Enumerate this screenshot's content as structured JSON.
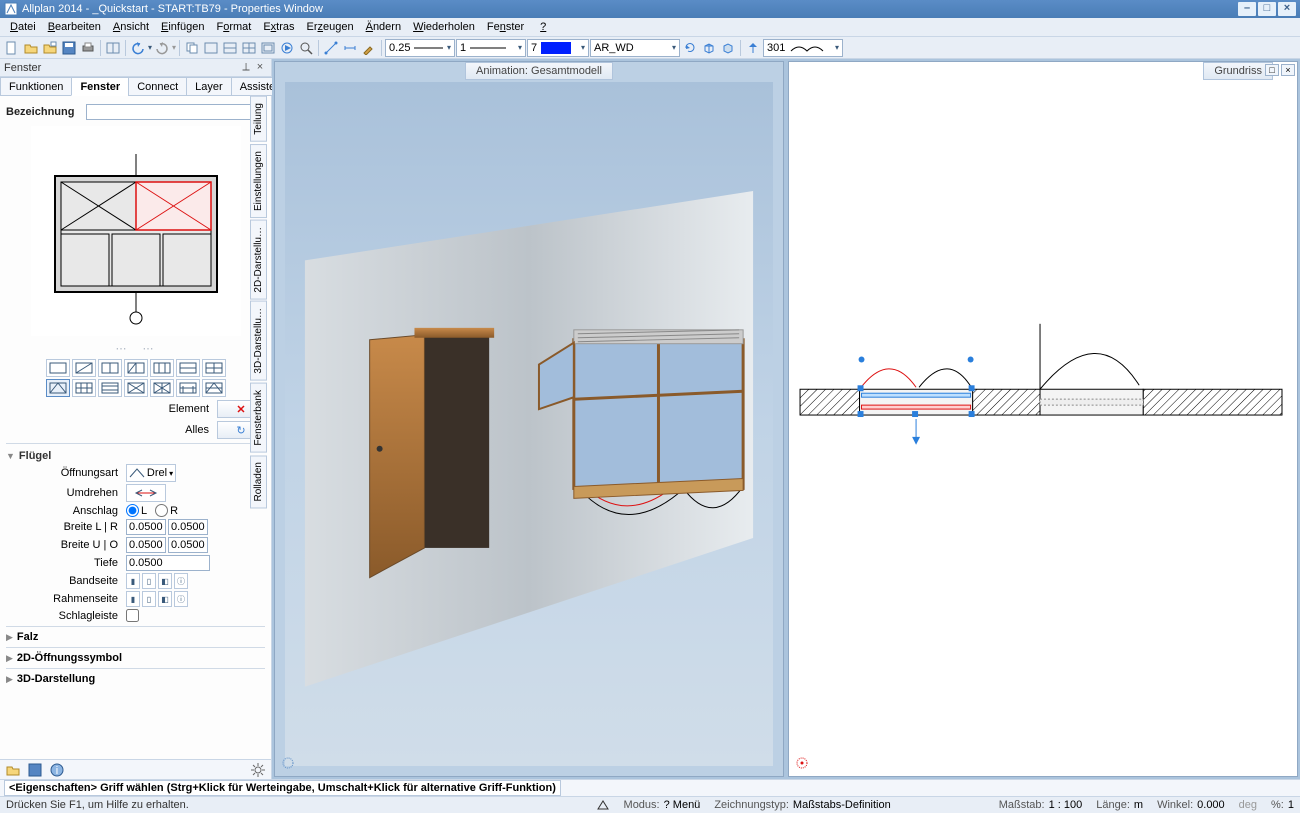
{
  "title": "Allplan 2014 - _Quickstart - START:TB79 - Properties Window",
  "menus": [
    "Datei",
    "Bearbeiten",
    "Ansicht",
    "Einfügen",
    "Format",
    "Extras",
    "Erzeugen",
    "Ändern",
    "Wiederholen",
    "Fenster",
    "?"
  ],
  "menu_accel": [
    "D",
    "B",
    "A",
    "E",
    "o",
    "x",
    "z",
    "Ä",
    "W",
    "n",
    ""
  ],
  "toolbar": {
    "line_weight": "0.25",
    "line_type": "1",
    "color_index": "7",
    "layer": "AR_WD",
    "draw_order": "301"
  },
  "left_panel": {
    "title": "Fenster",
    "tabs": [
      "Funktionen",
      "Fenster",
      "Connect",
      "Layer",
      "Assistenten"
    ],
    "active_tab": 1,
    "bezeichnung_label": "Bezeichnung",
    "element_label": "Element",
    "alles_label": "Alles",
    "fluegel_hd": "Flügel",
    "oeffnungsart_label": "Öffnungsart",
    "oeffnungsart_value": "Drel",
    "umdrehen_label": "Umdrehen",
    "anschlag_label": "Anschlag",
    "anschlag_L": "L",
    "anschlag_R": "R",
    "breite_lr_label": "Breite L | R",
    "breite_uo_label": "Breite U | O",
    "tiefe_label": "Tiefe",
    "breite_l": "0.0500",
    "breite_r": "0.0500",
    "breite_u": "0.0500",
    "breite_o": "0.0500",
    "tiefe": "0.0500",
    "bandseite_label": "Bandseite",
    "rahmenseite_label": "Rahmenseite",
    "schlagleiste_label": "Schlagleiste",
    "collapsed": [
      "Falz",
      "2D-Öffnungssymbol",
      "3D-Darstellung"
    ]
  },
  "side_tabs": [
    "Teilung",
    "Einstellungen",
    "2D-Darstellu…",
    "3D-Darstellu…",
    "Fensterbank",
    "Rolladen"
  ],
  "view3d_tab": "Animation: Gesamtmodell",
  "view2d_tab": "Grundriss",
  "status_hint": "<Eigenschaften> Griff wählen (Strg+Klick für Werteingabe, Umschalt+Klick für alternative Griff-Funktion)",
  "help_hint": "Drücken Sie F1, um Hilfe zu erhalten.",
  "status": {
    "modus_l": "Modus:",
    "modus_v": "? Menü",
    "zt_l": "Zeichnungstyp:",
    "zt_v": "Maßstabs-Definition",
    "mass_l": "Maßstab:",
    "mass_v": "1 : 100",
    "laenge_l": "Länge:",
    "laenge_v": "m",
    "winkel_l": "Winkel:",
    "winkel_v": "0.000",
    "deg": "deg",
    "pct_l": "%:",
    "pct_v": "1"
  }
}
